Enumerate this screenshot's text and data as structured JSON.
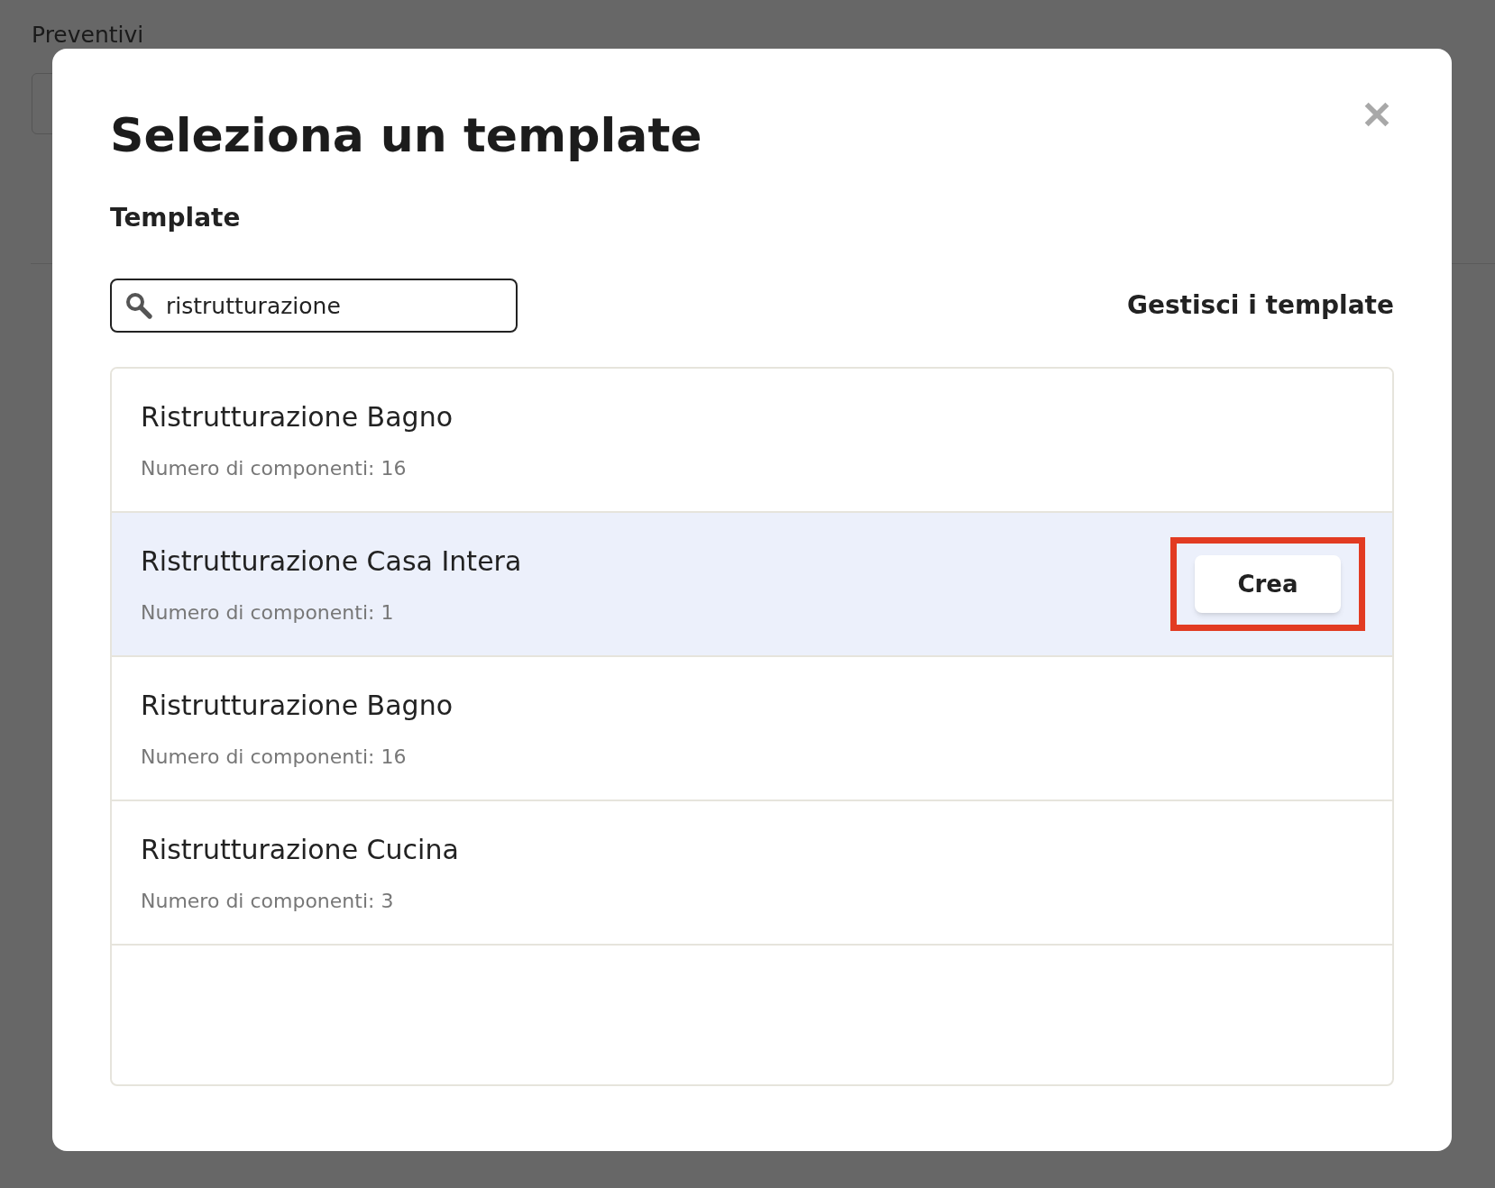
{
  "page": {
    "title": "Preventivi"
  },
  "dialog": {
    "title": "Seleziona un template",
    "section_label": "Template",
    "search": {
      "value": "ristrutturazione"
    },
    "manage_link": "Gestisci i template",
    "templates": [
      {
        "name": "Ristrutturazione Bagno",
        "components": "Numero di componenti: 16",
        "selected": false
      },
      {
        "name": "Ristrutturazione Casa Intera",
        "components": "Numero di componenti: 1",
        "selected": true,
        "action": "Crea"
      },
      {
        "name": "Ristrutturazione Bagno",
        "components": "Numero di componenti: 16",
        "selected": false
      },
      {
        "name": "Ristrutturazione Cucina",
        "components": "Numero di componenti: 3",
        "selected": false
      }
    ]
  }
}
